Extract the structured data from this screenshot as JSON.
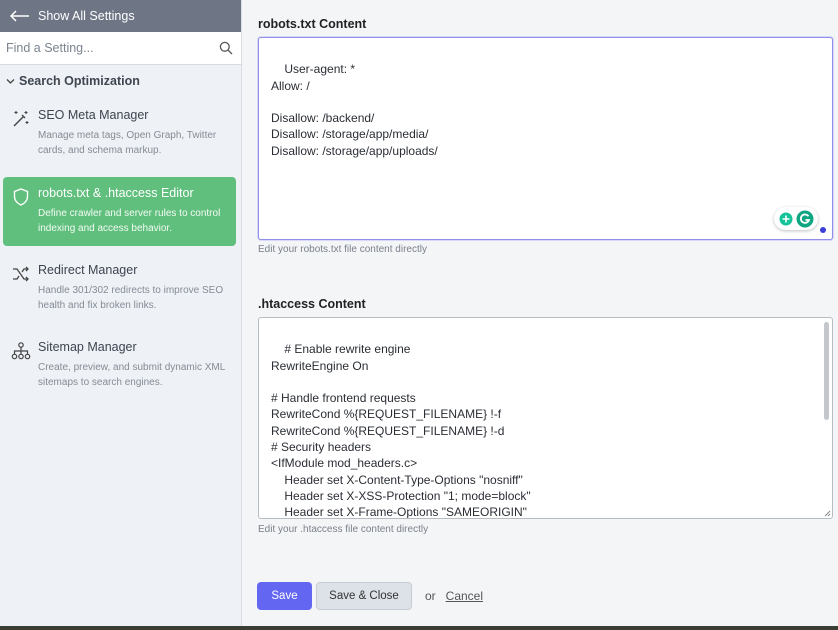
{
  "sidebar": {
    "back_label": "Show All Settings",
    "search_placeholder": "Find a Setting...",
    "section_label": "Search Optimization",
    "items": [
      {
        "icon": "magic-wand-icon",
        "title": "SEO Meta Manager",
        "desc": "Manage meta tags, Open Graph, Twitter cards, and schema markup.",
        "active": false
      },
      {
        "icon": "shield-icon",
        "title": "robots.txt & .htaccess Editor",
        "desc": "Define crawler and server rules to control indexing and access behavior.",
        "active": true
      },
      {
        "icon": "shuffle-icon",
        "title": "Redirect Manager",
        "desc": "Handle 301/302 redirects to improve SEO health and fix broken links.",
        "active": false
      },
      {
        "icon": "sitemap-icon",
        "title": "Sitemap Manager",
        "desc": "Create, preview, and submit dynamic XML sitemaps to search engines.",
        "active": false
      }
    ]
  },
  "robots": {
    "label": "robots.txt Content",
    "content": "User-agent: *\nAllow: /\n\nDisallow: /backend/\nDisallow: /storage/app/media/\nDisallow: /storage/app/uploads/",
    "help": "Edit your robots.txt file content directly"
  },
  "htaccess": {
    "label": ".htaccess Content",
    "content": "# Enable rewrite engine\nRewriteEngine On\n\n# Handle frontend requests\nRewriteCond %{REQUEST_FILENAME} !-f\nRewriteCond %{REQUEST_FILENAME} !-d\n# Security headers\n<IfModule mod_headers.c>\n    Header set X-Content-Type-Options \"nosniff\"\n    Header set X-XSS-Protection \"1; mode=block\"\n    Header set X-Frame-Options \"SAMEORIGIN\"\n    Header set Referrer-Policy \"strict-origin-when-cross-origin\"",
    "help": "Edit your .htaccess file content directly"
  },
  "actions": {
    "save": "Save",
    "save_close": "Save & Close",
    "or": "or",
    "cancel": "Cancel"
  },
  "colors": {
    "accent": "#6366f1",
    "active_item": "#61bf7d",
    "sidebar_header": "#6e7686"
  }
}
